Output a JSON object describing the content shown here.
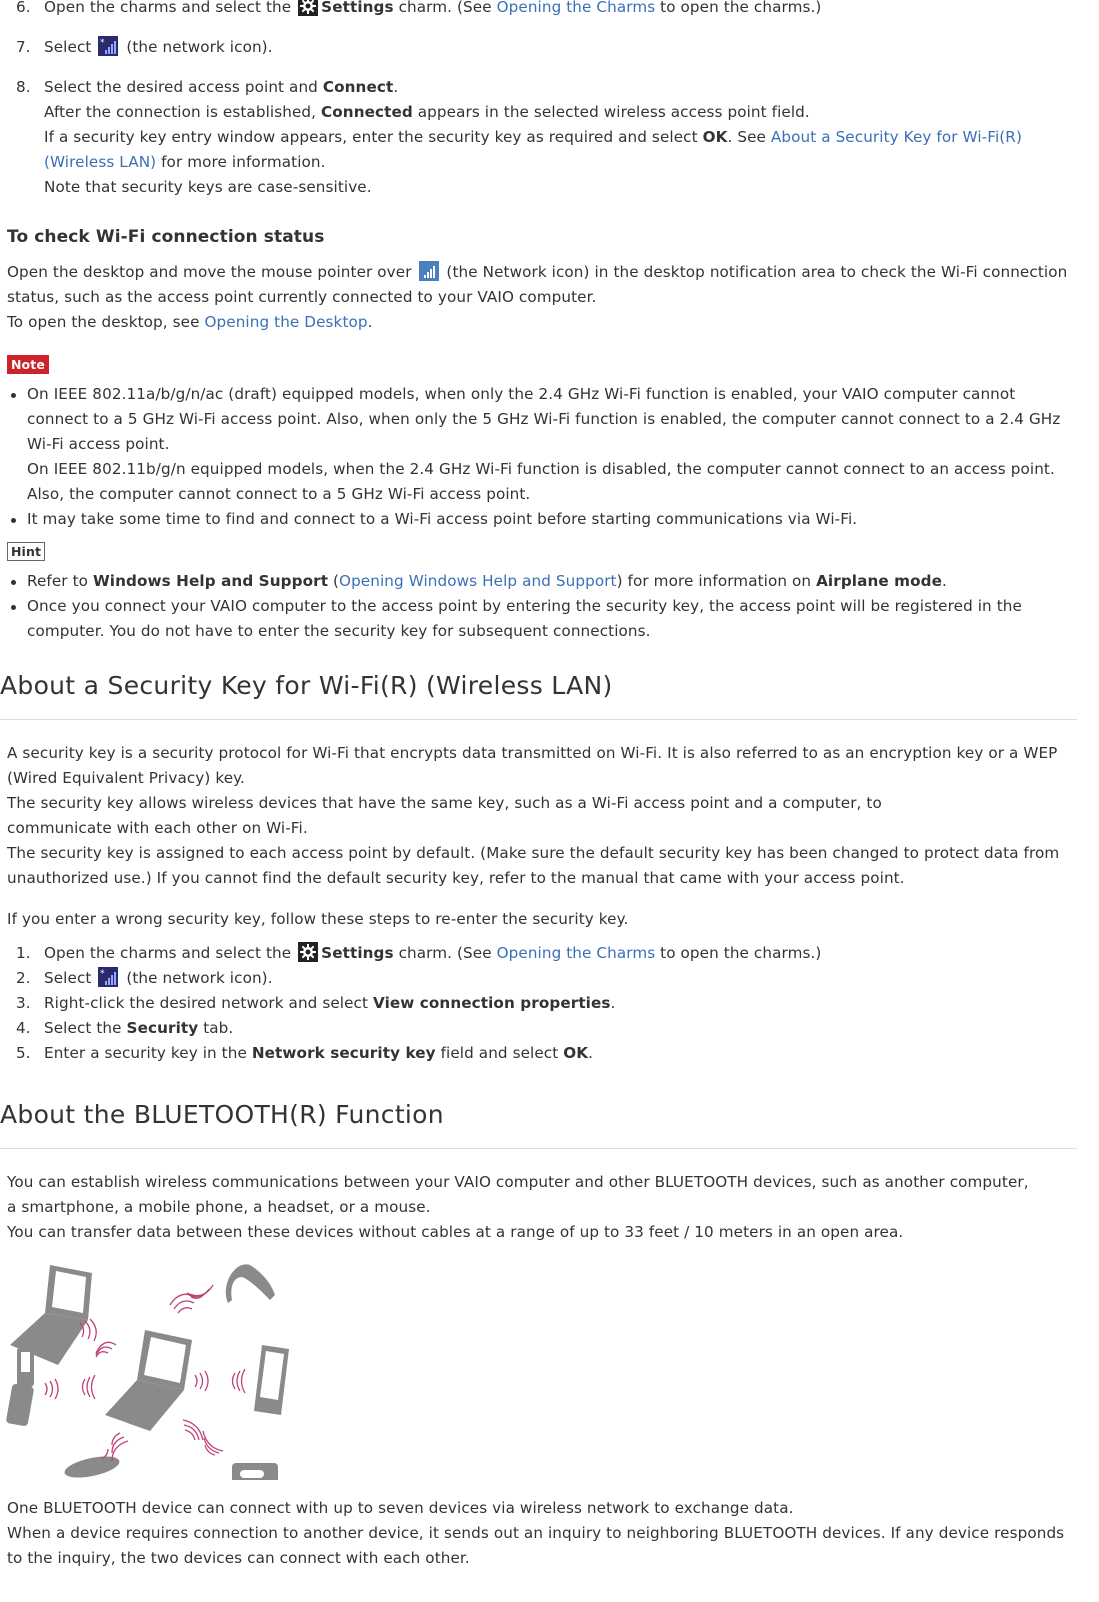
{
  "steps_top": [
    {
      "num": "6.",
      "pre": "Open the charms and select the ",
      "icon": "settings-gear-icon",
      "bold": "Settings",
      "mid": " charm. (See ",
      "link": "Opening the Charms",
      "post": " to open the charms.)"
    },
    {
      "num": "7.",
      "pre": "Select ",
      "icon": "network-icon",
      "post": " (the network icon)."
    },
    {
      "num": "8.",
      "pre": "Select the desired access point and ",
      "bold": "Connect",
      "post": ".",
      "line2_pre": "After the connection is established, ",
      "line2_bold": "Connected",
      "line2_post": " appears in the selected wireless access point field.",
      "line3_pre": "If a security key entry window appears, enter the security key as required and select ",
      "line3_bold": "OK",
      "line3_mid": ". See ",
      "line3_link": "About a Security Key for Wi-Fi(R) (Wireless LAN)",
      "line3_post": " for more information.",
      "line4": "Note that security keys are case-sensitive."
    }
  ],
  "check_status": {
    "heading": "To check Wi-Fi connection status",
    "p1_pre": "Open the desktop and move the mouse pointer over ",
    "p1_icon": "network-taskbar-icon",
    "p1_post": " (the Network icon) in the desktop notification area to check the Wi-Fi connection status, such as the access point currently connected to your VAIO computer.",
    "p2_pre": "To open the desktop, see ",
    "p2_link": "Opening the Desktop",
    "p2_post": "."
  },
  "note": {
    "label": "Note",
    "items": [
      {
        "l1": "On IEEE 802.11a/b/g/n/ac (draft) equipped models, when only the 2.4 GHz Wi-Fi function is enabled, your VAIO computer cannot connect to a 5 GHz Wi-Fi access point. Also, when only the 5 GHz Wi-Fi function is enabled, the computer cannot connect to a 2.4 GHz Wi-Fi access point.",
        "l2": "On IEEE 802.11b/g/n equipped models, when the 2.4 GHz Wi-Fi function is disabled, the computer cannot connect to an access point. Also, the computer cannot connect to a 5 GHz Wi-Fi access point."
      },
      {
        "l1": "It may take some time to find and connect to a Wi-Fi access point before starting communications via Wi-Fi."
      }
    ]
  },
  "hint": {
    "label": "Hint",
    "item1_pre": "Refer to ",
    "item1_bold": "Windows Help and Support",
    "item1_mid": " (",
    "item1_link": "Opening Windows Help and Support",
    "item1_mid2": ") for more information on ",
    "item1_bold2": "Airplane mode",
    "item1_post": ".",
    "item2": "Once you connect your VAIO computer to the access point by entering the security key, the access point will be registered in the computer. You do not have to enter the security key for subsequent connections."
  },
  "security_key": {
    "heading": "About a Security Key for Wi-Fi(R) (Wireless LAN)",
    "p1": "A security key is a security protocol for Wi-Fi that encrypts data transmitted on Wi-Fi. It is also referred to as an encryption key or a WEP (Wired Equivalent Privacy) key.",
    "p2": "The security key allows wireless devices that have the same key, such as a Wi-Fi access point and a computer, to communicate with each other on Wi-Fi.",
    "p3": "The security key is assigned to each access point by default. (Make sure the default security key has been changed to protect data from unauthorized use.) If you cannot find the default security key, refer to the manual that came with your access point.",
    "p4": "If you enter a wrong security key, follow these steps to re-enter the security key.",
    "steps": [
      {
        "num": "1.",
        "pre": "Open the charms and select the ",
        "bold": "Settings",
        "mid": " charm. (See ",
        "link": "Opening the Charms",
        "post": " to open the charms.)"
      },
      {
        "num": "2.",
        "pre": "Select ",
        "post": " (the network icon)."
      },
      {
        "num": "3.",
        "pre": "Right-click the desired network and select ",
        "bold": "View connection properties",
        "post": "."
      },
      {
        "num": "4.",
        "pre": "Select the ",
        "bold": "Security",
        "post": " tab."
      },
      {
        "num": "5.",
        "pre": "Enter a security key in the ",
        "bold": "Network security key",
        "mid": " field and select ",
        "bold2": "OK",
        "post": "."
      }
    ]
  },
  "bluetooth": {
    "heading": "About the BLUETOOTH(R) Function",
    "p1": "You can establish wireless communications between your VAIO computer and other BLUETOOTH devices, such as another computer, a smartphone, a mobile phone, a headset, or a mouse.",
    "p2": "You can transfer data between these devices without cables at a range of up to 33 feet / 10 meters in an open area.",
    "illustration": "bluetooth-devices-illustration",
    "p3": "One BLUETOOTH device can connect with up to seven devices via wireless network to exchange data.",
    "p4": "When a device requires connection to another device, it sends out an inquiry to neighboring BLUETOOTH devices. If any device responds to the inquiry, the two devices can connect with each other."
  },
  "colors": {
    "link": "#3a6fb8",
    "note_badge": "#cc2229",
    "text": "#333333",
    "wave": "#c0407a",
    "device": "#8a8a8a"
  }
}
